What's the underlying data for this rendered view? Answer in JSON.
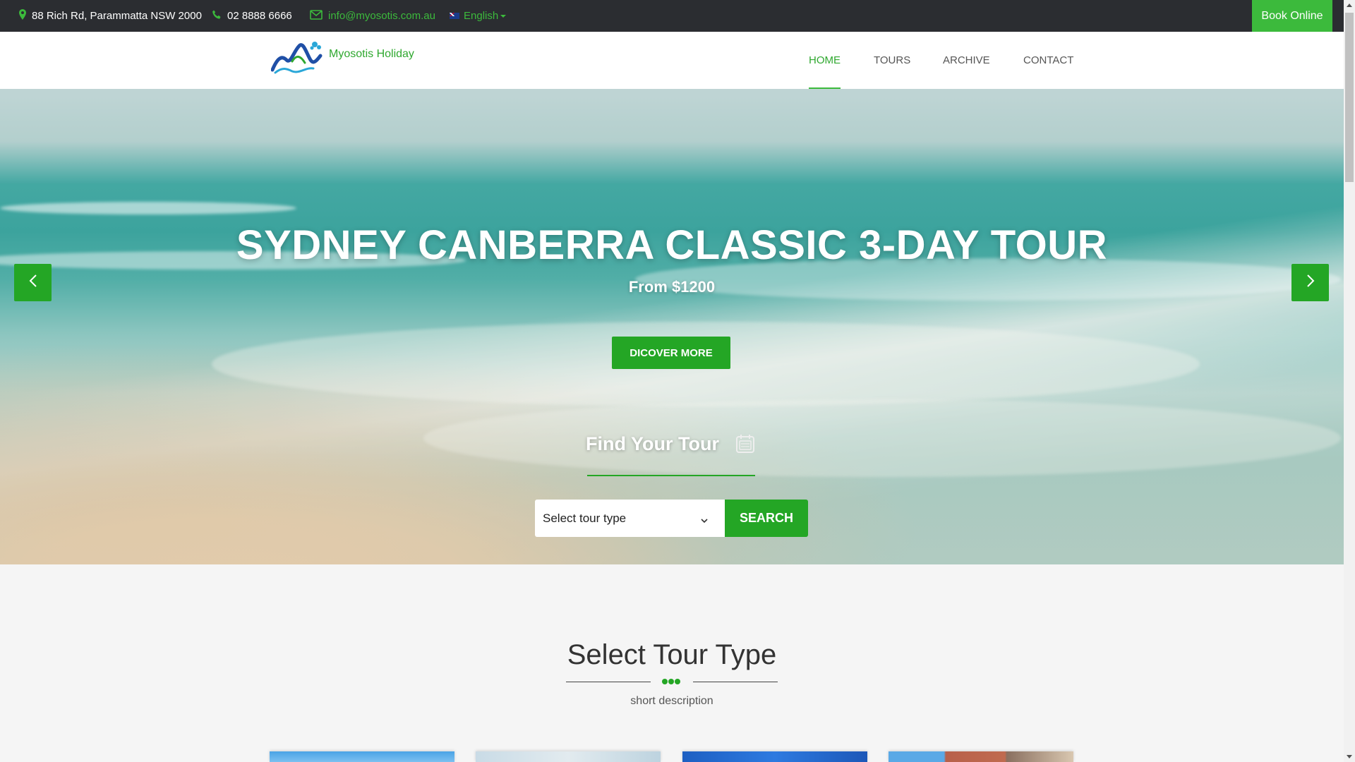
{
  "topbar": {
    "address": "88 Rich Rd, Parammatta NSW 2000",
    "phone": "02 8888 6666",
    "email": "info@myosotis.com.au",
    "language": "English",
    "book_online": "Book Online",
    "icons": [
      "map-pin-icon",
      "phone-icon",
      "envelope-icon",
      "australia-flag-icon"
    ]
  },
  "header": {
    "logo_text": "Myosotis Holiday",
    "nav": [
      {
        "label": "HOME",
        "active": true
      },
      {
        "label": "TOURS",
        "active": false
      },
      {
        "label": "ARCHIVE",
        "active": false
      },
      {
        "label": "CONTACT",
        "active": false
      }
    ]
  },
  "hero": {
    "title": "SYDNEY CANBERRA CLASSIC 3-DAY TOUR",
    "price": "From $1200",
    "cta": "DICOVER MORE",
    "find_title": "Find Your Tour",
    "select_placeholder": "Select tour type",
    "search_label": "SEARCH"
  },
  "section": {
    "title": "Select Tour Type",
    "description": "short description"
  },
  "colors": {
    "accent": "#24a625",
    "topbar_bg": "#2b2d31",
    "link_green": "#3cba3c"
  }
}
